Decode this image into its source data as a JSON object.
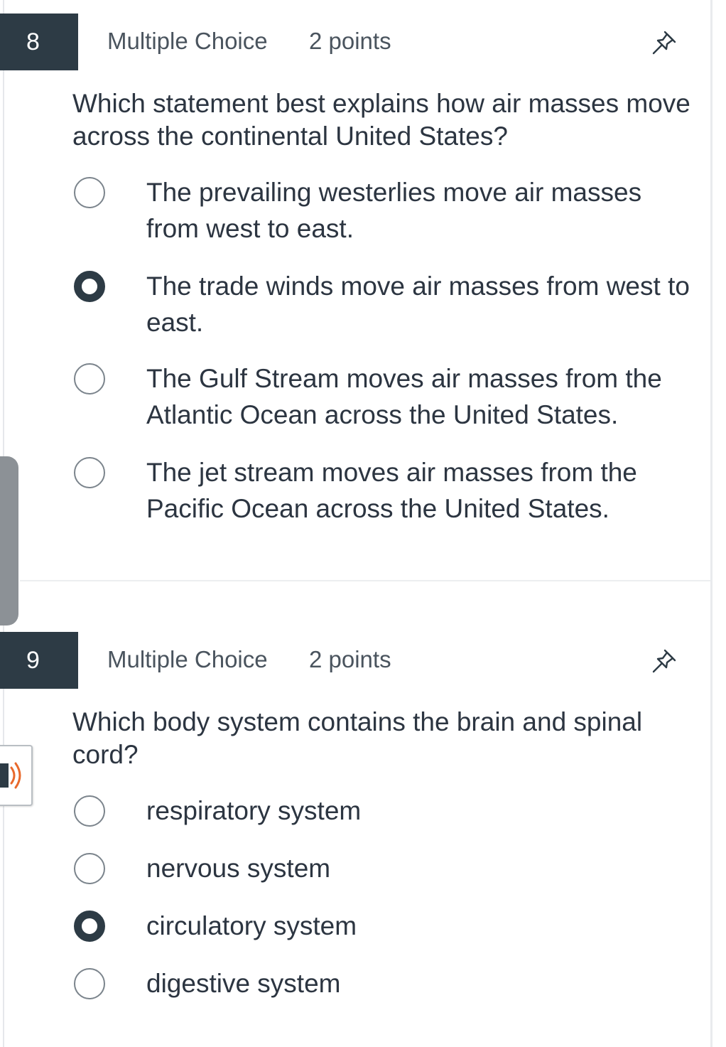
{
  "questions": [
    {
      "number": "8",
      "type": "Multiple Choice",
      "points": "2 points",
      "text": "Which statement best explains how air masses move across the continental United States?",
      "options": [
        {
          "label": "The prevailing westerlies move air masses from west to east.",
          "selected": false
        },
        {
          "label": "The trade winds move air masses from west to east.",
          "selected": true
        },
        {
          "label": "The Gulf Stream moves air masses from the Atlantic Ocean across the United States.",
          "selected": false
        },
        {
          "label": "The jet stream moves air masses from the Pacific Ocean across the United States.",
          "selected": false
        }
      ]
    },
    {
      "number": "9",
      "type": "Multiple Choice",
      "points": "2 points",
      "text": "Which body system contains the brain and spinal cord?",
      "options": [
        {
          "label": "respiratory system",
          "selected": false
        },
        {
          "label": "nervous system",
          "selected": false
        },
        {
          "label": "circulatory system",
          "selected": true
        },
        {
          "label": "digestive system",
          "selected": false
        }
      ]
    }
  ],
  "icons": {
    "pin": "pushpin-icon",
    "audio": "speaker-icon",
    "side_handle": "chevron-right-icon"
  },
  "colors": {
    "number_badge_bg": "#2d3b45",
    "text": "#2c3541",
    "radio_border": "#7b848c",
    "audio_orange": "#e8692c"
  }
}
